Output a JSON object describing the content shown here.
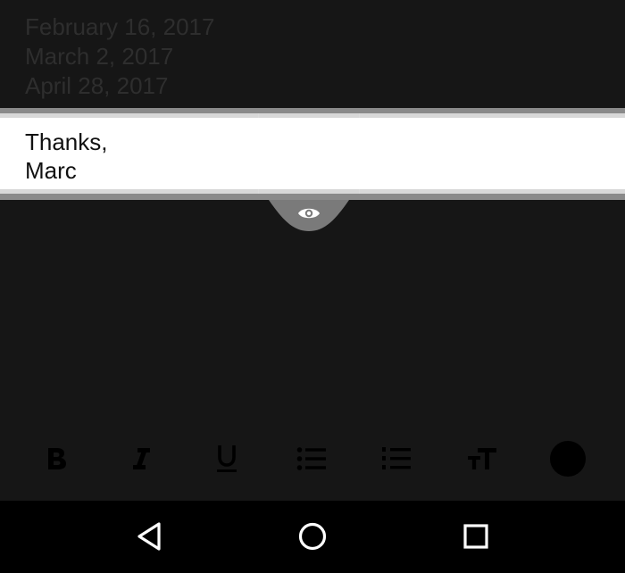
{
  "background_lines": [
    "February 16, 2017",
    "March 2, 2017",
    "April 28, 2017"
  ],
  "magnified_lines": [
    "Thanks,",
    "Marc"
  ],
  "magnifier_handle_icon": "eye-icon",
  "toolbar_icons": [
    "bold-icon",
    "italic-icon",
    "underline-icon",
    "bulleted-list-icon",
    "numbered-list-icon",
    "text-size-icon",
    "text-color-icon"
  ],
  "nav_icons": [
    "back-icon",
    "home-icon",
    "recents-icon"
  ],
  "colors": {
    "app_background": "#161616",
    "dim_text": "#2e2e2e",
    "magnifier_background": "#ffffff",
    "handle": "#7a7a7a",
    "toolbar_icon": "#000000",
    "nav_bar": "#000000",
    "nav_icon": "#ffffff"
  }
}
